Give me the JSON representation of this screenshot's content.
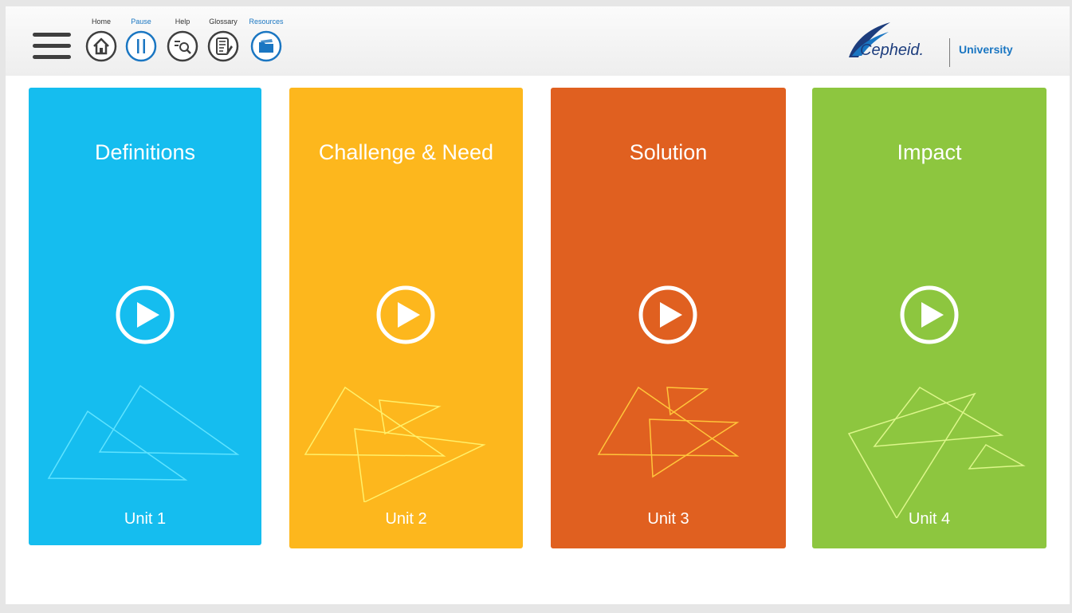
{
  "nav": {
    "home_label": "Home",
    "pause_label": "Pause",
    "help_label": "Help",
    "glossary_label": "Glossary",
    "resources_label": "Resources"
  },
  "brand": {
    "name": "Cepheid.",
    "section": "University"
  },
  "units": [
    {
      "title": "Definitions",
      "unit": "Unit 1",
      "color": "#15bdef",
      "line_color": "#5fe3ff"
    },
    {
      "title": "Challenge & Need",
      "unit": "Unit 2",
      "color": "#fdb71d",
      "line_color": "#fff06a"
    },
    {
      "title": "Solution",
      "unit": "Unit 3",
      "color": "#e06020",
      "line_color": "#ffc53a"
    },
    {
      "title": "Impact",
      "unit": "Unit 4",
      "color": "#8dc63f",
      "line_color": "#dcf68a"
    }
  ],
  "colors": {
    "accent": "#1a76c2",
    "icon": "#3f3f3f"
  }
}
